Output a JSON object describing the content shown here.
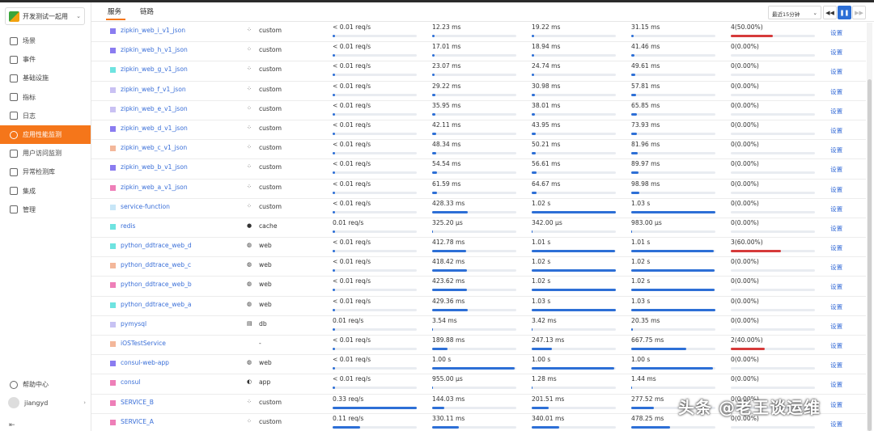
{
  "workspace": {
    "name": "开发测试一起用"
  },
  "sidebar": {
    "items": [
      {
        "label": "场景",
        "icon": "monitor-icon"
      },
      {
        "label": "事件",
        "icon": "flag-icon"
      },
      {
        "label": "基础设施",
        "icon": "grid-icon"
      },
      {
        "label": "指标",
        "icon": "bar-chart-icon"
      },
      {
        "label": "日志",
        "icon": "log-icon"
      },
      {
        "label": "应用性能监测",
        "icon": "target-icon",
        "active": true
      },
      {
        "label": "用户访问监测",
        "icon": "user-monitor-icon"
      },
      {
        "label": "异常检测库",
        "icon": "radar-icon"
      },
      {
        "label": "集成",
        "icon": "shield-icon"
      },
      {
        "label": "管理",
        "icon": "sliders-icon"
      }
    ],
    "help": "帮助中心",
    "user": "jiangyd"
  },
  "header": {
    "tabs": [
      "服务",
      "链路"
    ],
    "time_range": "最近15分钟",
    "controls": [
      "◀◀",
      "❚❚",
      "▶▶"
    ]
  },
  "table": {
    "setting_label": "设置",
    "rows": [
      {
        "color": "#8a7cf0",
        "service": "zipkin_web_i_v1_json",
        "type_icon": "custom-icon",
        "type": "custom",
        "req": "< 0.01 req/s",
        "req_pct": 3,
        "c2": "12.23 ms",
        "c2_pct": 3,
        "c3": "19.22 ms",
        "c3_pct": 3,
        "c4": "31.15 ms",
        "c4_pct": 3,
        "err": "4(50.00%)",
        "err_pct": 50
      },
      {
        "color": "#8a7cf0",
        "service": "zipkin_web_h_v1_json",
        "type_icon": "custom-icon",
        "type": "custom",
        "req": "< 0.01 req/s",
        "req_pct": 3,
        "c2": "17.01 ms",
        "c2_pct": 3,
        "c3": "18.94 ms",
        "c3_pct": 3,
        "c4": "41.46 ms",
        "c4_pct": 4,
        "err": "0(0.00%)",
        "err_pct": 0
      },
      {
        "color": "#6ee3e0",
        "service": "zipkin_web_g_v1_json",
        "type_icon": "custom-icon",
        "type": "custom",
        "req": "< 0.01 req/s",
        "req_pct": 3,
        "c2": "23.07 ms",
        "c2_pct": 3,
        "c3": "24.74 ms",
        "c3_pct": 3,
        "c4": "49.61 ms",
        "c4_pct": 5,
        "err": "0(0.00%)",
        "err_pct": 0
      },
      {
        "color": "#c9c1f3",
        "service": "zipkin_web_f_v1_json",
        "type_icon": "custom-icon",
        "type": "custom",
        "req": "< 0.01 req/s",
        "req_pct": 3,
        "c2": "29.22 ms",
        "c2_pct": 4,
        "c3": "30.98 ms",
        "c3_pct": 4,
        "c4": "57.81 ms",
        "c4_pct": 6,
        "err": "0(0.00%)",
        "err_pct": 0
      },
      {
        "color": "#c9c1f3",
        "service": "zipkin_web_e_v1_json",
        "type_icon": "custom-icon",
        "type": "custom",
        "req": "< 0.01 req/s",
        "req_pct": 3,
        "c2": "35.95 ms",
        "c2_pct": 4,
        "c3": "38.01 ms",
        "c3_pct": 4,
        "c4": "65.85 ms",
        "c4_pct": 7,
        "err": "0(0.00%)",
        "err_pct": 0
      },
      {
        "color": "#8a7cf0",
        "service": "zipkin_web_d_v1_json",
        "type_icon": "custom-icon",
        "type": "custom",
        "req": "< 0.01 req/s",
        "req_pct": 3,
        "c2": "42.11 ms",
        "c2_pct": 5,
        "c3": "43.95 ms",
        "c3_pct": 5,
        "c4": "73.93 ms",
        "c4_pct": 7,
        "err": "0(0.00%)",
        "err_pct": 0
      },
      {
        "color": "#f3b79a",
        "service": "zipkin_web_c_v1_json",
        "type_icon": "custom-icon",
        "type": "custom",
        "req": "< 0.01 req/s",
        "req_pct": 3,
        "c2": "48.34 ms",
        "c2_pct": 5,
        "c3": "50.21 ms",
        "c3_pct": 5,
        "c4": "81.96 ms",
        "c4_pct": 8,
        "err": "0(0.00%)",
        "err_pct": 0
      },
      {
        "color": "#8a7cf0",
        "service": "zipkin_web_b_v1_json",
        "type_icon": "custom-icon",
        "type": "custom",
        "req": "< 0.01 req/s",
        "req_pct": 3,
        "c2": "54.54 ms",
        "c2_pct": 6,
        "c3": "56.61 ms",
        "c3_pct": 6,
        "c4": "89.97 ms",
        "c4_pct": 9,
        "err": "0(0.00%)",
        "err_pct": 0
      },
      {
        "color": "#ee7fb8",
        "service": "zipkin_web_a_v1_json",
        "type_icon": "custom-icon",
        "type": "custom",
        "req": "< 0.01 req/s",
        "req_pct": 3,
        "c2": "61.59 ms",
        "c2_pct": 6,
        "c3": "64.67 ms",
        "c3_pct": 6,
        "c4": "98.98 ms",
        "c4_pct": 10,
        "err": "0(0.00%)",
        "err_pct": 0
      },
      {
        "color": "#c7e6f7",
        "service": "service-function",
        "type_icon": "custom-icon",
        "type": "custom",
        "req": "< 0.01 req/s",
        "req_pct": 3,
        "c2": "428.33 ms",
        "c2_pct": 42,
        "c3": "1.02 s",
        "c3_pct": 100,
        "c4": "1.03 s",
        "c4_pct": 100,
        "err": "0(0.00%)",
        "err_pct": 0
      },
      {
        "color": "#6ee3e0",
        "service": "redis",
        "type_icon": "cache-icon",
        "type": "cache",
        "req": "0.01 req/s",
        "req_pct": 3,
        "c2": "325.20 µs",
        "c2_pct": 1,
        "c3": "342.00 µs",
        "c3_pct": 1,
        "c4": "983.00 µs",
        "c4_pct": 1,
        "err": "0(0.00%)",
        "err_pct": 0
      },
      {
        "color": "#6ee3e0",
        "service": "python_ddtrace_web_d",
        "type_icon": "web-icon",
        "type": "web",
        "req": "< 0.01 req/s",
        "req_pct": 3,
        "c2": "412.78 ms",
        "c2_pct": 40,
        "c3": "1.01 s",
        "c3_pct": 99,
        "c4": "1.01 s",
        "c4_pct": 98,
        "err": "3(60.00%)",
        "err_pct": 60
      },
      {
        "color": "#f3b79a",
        "service": "python_ddtrace_web_c",
        "type_icon": "web-icon",
        "type": "web",
        "req": "< 0.01 req/s",
        "req_pct": 3,
        "c2": "418.42 ms",
        "c2_pct": 41,
        "c3": "1.02 s",
        "c3_pct": 100,
        "c4": "1.02 s",
        "c4_pct": 99,
        "err": "0(0.00%)",
        "err_pct": 0
      },
      {
        "color": "#ee7fb8",
        "service": "python_ddtrace_web_b",
        "type_icon": "web-icon",
        "type": "web",
        "req": "< 0.01 req/s",
        "req_pct": 3,
        "c2": "423.62 ms",
        "c2_pct": 41,
        "c3": "1.02 s",
        "c3_pct": 100,
        "c4": "1.02 s",
        "c4_pct": 99,
        "err": "0(0.00%)",
        "err_pct": 0
      },
      {
        "color": "#6ee3e0",
        "service": "python_ddtrace_web_a",
        "type_icon": "web-icon",
        "type": "web",
        "req": "< 0.01 req/s",
        "req_pct": 3,
        "c2": "429.36 ms",
        "c2_pct": 42,
        "c3": "1.03 s",
        "c3_pct": 100,
        "c4": "1.03 s",
        "c4_pct": 100,
        "err": "0(0.00%)",
        "err_pct": 0
      },
      {
        "color": "#c7c2f3",
        "service": "pymysql",
        "type_icon": "db-icon",
        "type": "db",
        "req": "0.01 req/s",
        "req_pct": 3,
        "c2": "3.54 ms",
        "c2_pct": 1,
        "c3": "3.42 ms",
        "c3_pct": 1,
        "c4": "20.35 ms",
        "c4_pct": 2,
        "err": "0(0.00%)",
        "err_pct": 0
      },
      {
        "color": "#f3b79a",
        "service": "iOSTestService",
        "type_icon": "",
        "type": "-",
        "req": "< 0.01 req/s",
        "req_pct": 3,
        "c2": "189.88 ms",
        "c2_pct": 18,
        "c3": "247.13 ms",
        "c3_pct": 24,
        "c4": "667.75 ms",
        "c4_pct": 65,
        "err": "2(40.00%)",
        "err_pct": 40
      },
      {
        "color": "#8a7cf0",
        "service": "consul-web-app",
        "type_icon": "web-icon",
        "type": "web",
        "req": "< 0.01 req/s",
        "req_pct": 3,
        "c2": "1.00 s",
        "c2_pct": 98,
        "c3": "1.00 s",
        "c3_pct": 98,
        "c4": "1.00 s",
        "c4_pct": 97,
        "err": "0(0.00%)",
        "err_pct": 0
      },
      {
        "color": "#ee7fb8",
        "service": "consul",
        "type_icon": "app-icon",
        "type": "app",
        "req": "< 0.01 req/s",
        "req_pct": 3,
        "c2": "955.00 µs",
        "c2_pct": 1,
        "c3": "1.28 ms",
        "c3_pct": 1,
        "c4": "1.44 ms",
        "c4_pct": 1,
        "err": "0(0.00%)",
        "err_pct": 0
      },
      {
        "color": "#ee7fb8",
        "service": "SERVICE_B",
        "type_icon": "custom-icon",
        "type": "custom",
        "req": "0.33 req/s",
        "req_pct": 100,
        "c2": "144.03 ms",
        "c2_pct": 14,
        "c3": "201.51 ms",
        "c3_pct": 20,
        "c4": "277.52 ms",
        "c4_pct": 27,
        "err": "0(0.00%)",
        "err_pct": 0
      },
      {
        "color": "#ee7fb8",
        "service": "SERVICE_A",
        "type_icon": "custom-icon",
        "type": "custom",
        "req": "0.11 req/s",
        "req_pct": 33,
        "c2": "330.11 ms",
        "c2_pct": 32,
        "c3": "340.01 ms",
        "c3_pct": 33,
        "c4": "478.25 ms",
        "c4_pct": 46,
        "err": "0(0.00%)",
        "err_pct": 0
      }
    ]
  },
  "watermark": "头条 @老王谈运维"
}
